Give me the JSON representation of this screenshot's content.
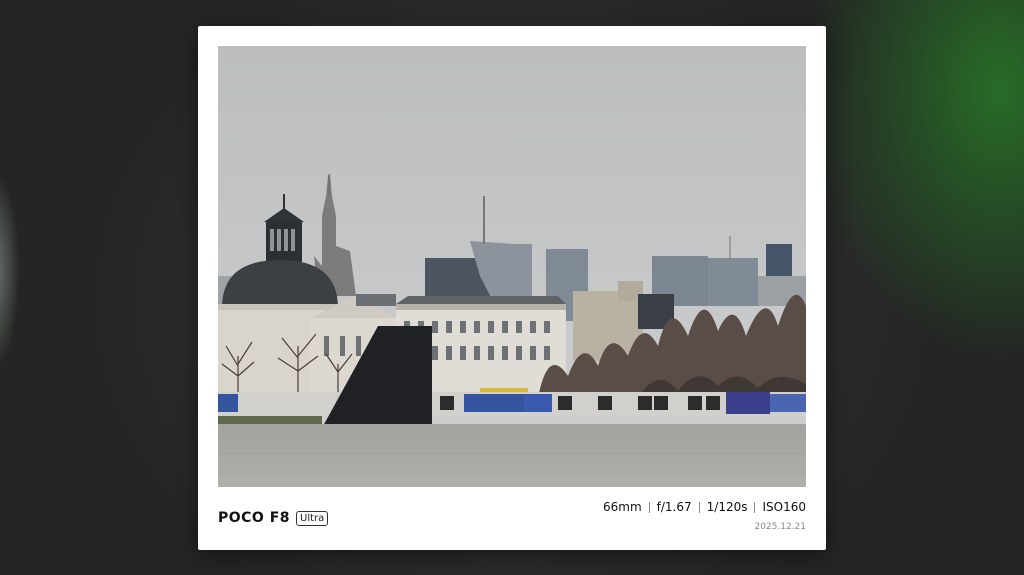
{
  "frame": {
    "brand_name": "POCO F8",
    "brand_badge": "Ultra",
    "exif": {
      "focal_length": "66mm",
      "aperture": "f/1.67",
      "shutter": "1/120s",
      "iso": "ISO160"
    },
    "date": "2025.12.21"
  },
  "colors": {
    "sky": "#c4c5c6",
    "plaza": "#a9a7a3",
    "card": "#ffffff",
    "background": "#2a2b2a",
    "green_glow": "#2f7a2f"
  },
  "icons": [
    "ultra-badge"
  ]
}
